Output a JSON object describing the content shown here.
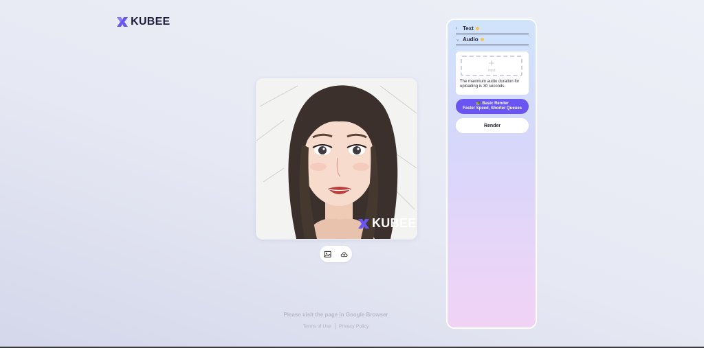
{
  "brand": {
    "name": "KUBEE",
    "accent": "#6a55f3"
  },
  "preview": {
    "watermark": "KUBEE"
  },
  "toolbar": {
    "icons": [
      "image-icon",
      "cloud-upload-icon"
    ]
  },
  "footer": {
    "note": "Please visit the page in Google Browser",
    "terms": "Terms of Use",
    "privacy": "Privacy Policy"
  },
  "panel": {
    "sections": [
      {
        "label": "Text",
        "state": "collapsed"
      },
      {
        "label": "Audio",
        "state": "expanded"
      }
    ],
    "upload": {
      "label": "Input",
      "note": "The maximum audio duration for uploading is 30 seconds."
    },
    "basic_render": {
      "emoji": "🐢",
      "line1": "Basic Render",
      "line2": "Faster Speed, Shorter Queues"
    },
    "render_label": "Render"
  }
}
